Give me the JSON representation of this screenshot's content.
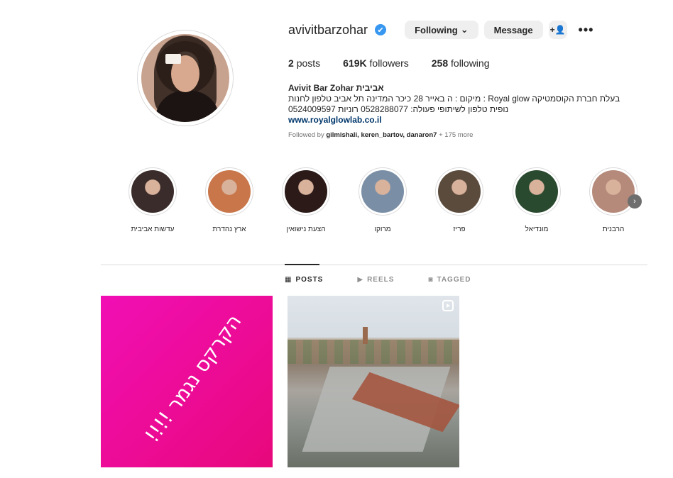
{
  "profile": {
    "username": "avivitbarzohar",
    "verified_glyph": "✔",
    "following_label": "Following",
    "following_chevron": "⌄",
    "message_label": "Message",
    "add_user_glyph": "+👤",
    "more_glyph": "•••",
    "stats": {
      "posts_count": "2",
      "posts_label": "posts",
      "followers_count": "619K",
      "followers_label": "followers",
      "following_count": "258",
      "following_label": "following"
    },
    "bio": {
      "name": "Avivit Bar Zohar אביבית",
      "line1": "מיקום : ה באייר 28 כיכר המדינה תל אביב טלפון לחנות : Royal glow בעלת חברת הקוסמטיקה",
      "line2": "0524009597 נופית טלפון לשיתופי פעולה: 0528288077 רוניות",
      "link": "www.royalglowlab.co.il"
    },
    "followed_by": {
      "prefix": "Followed by",
      "names": "gilmishali, keren_bartov, danaron7",
      "more": "+ 175 more"
    }
  },
  "highlights": [
    {
      "label": "עדשות אביבית",
      "color": "#3a2c2a"
    },
    {
      "label": "ארץ נהדרת",
      "color": "#c8764a"
    },
    {
      "label": "הצעת נישואין",
      "color": "#2b1a18"
    },
    {
      "label": "מרוקו",
      "color": "#7a8fa6"
    },
    {
      "label": "פריז",
      "color": "#5b4b3c"
    },
    {
      "label": "מונדיאל",
      "color": "#2a4a2f"
    },
    {
      "label": "הרבנית",
      "color": "#b58a7b"
    }
  ],
  "tabs": [
    {
      "label": "POSTS",
      "icon": "▦"
    },
    {
      "label": "REELS",
      "icon": "▶"
    },
    {
      "label": "TAGGED",
      "icon": "◙"
    }
  ],
  "posts": [
    {
      "text": "הקרקס נגמר !!!!"
    },
    {
      "text": ""
    }
  ]
}
